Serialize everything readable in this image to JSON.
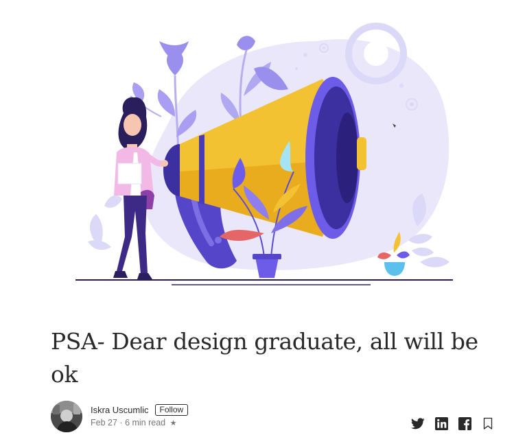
{
  "article": {
    "title": "PSA- Dear design graduate, all will be ok"
  },
  "author": {
    "name": "Iskra Uscumlic",
    "follow_label": "Follow",
    "date": "Feb 27",
    "separator": "·",
    "read_time": "6 min read",
    "member_star": "★"
  },
  "share_icons": [
    "twitter-icon",
    "linkedin-icon",
    "facebook-icon",
    "bookmark-icon"
  ],
  "colors": {
    "text": "#292929",
    "meta": "#757575",
    "illustration_lavender": "#E9E6FB",
    "illustration_purple": "#6C5CE7",
    "megaphone_yellow": "#F2C233",
    "jacket_pink": "#F2B8E6"
  }
}
